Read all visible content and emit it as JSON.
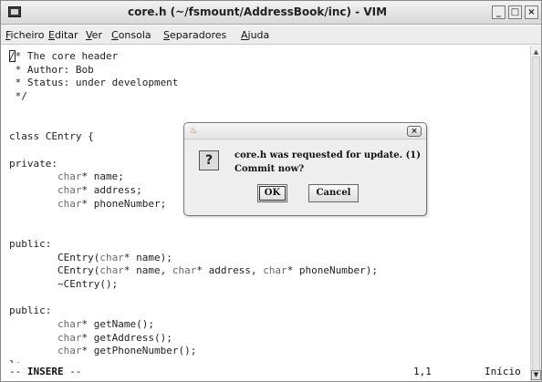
{
  "window": {
    "title": "core.h (~/fsmount/AddressBook/inc) - VIM",
    "minimize": "_",
    "maximize": "□",
    "close": "×"
  },
  "menu": [
    {
      "accel": "F",
      "rest": "icheiro"
    },
    {
      "accel": "E",
      "rest": "ditar"
    },
    {
      "accel": "V",
      "rest": "er"
    },
    {
      "accel": "C",
      "rest": "onsola"
    },
    {
      "accel": "S",
      "rest": "eparadores"
    },
    {
      "accel": "A",
      "rest": "juda"
    }
  ],
  "editor": {
    "lines": [
      "/* The core header",
      " * Author: Bob",
      " * Status: under development",
      " */",
      "",
      "",
      "class CEntry {",
      "",
      "private:",
      "        char* name;",
      "        char* address;",
      "        char* phoneNumber;",
      "",
      "",
      "public:",
      "        CEntry(char* name);",
      "        CEntry(char* name, char* address, char* phoneNumber);",
      "        ~CEntry();",
      "",
      "public:",
      "        char* getName();",
      "        char* getAddress();",
      "        char* getPhoneNumber();",
      "};"
    ]
  },
  "status": {
    "mode_prefix": "-- ",
    "mode": "INSERE",
    "mode_suffix": " --",
    "position": "1,1",
    "scroll": "Início"
  },
  "dialog": {
    "message_line1": "core.h was requested for update. (1)",
    "message_line2": "Commit now?",
    "ok_label": "OK",
    "cancel_label": "Cancel",
    "close": "×",
    "question_glyph": "?",
    "java_glyph": "♨"
  }
}
